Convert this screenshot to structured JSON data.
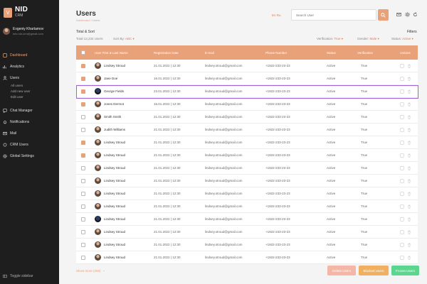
{
  "brand": {
    "logo_letter": "V",
    "name": "NID",
    "sub": "CRM"
  },
  "profile": {
    "name": "Evgeniy Khartamov",
    "email": "info.nid.crm@gmail.com"
  },
  "nav": {
    "dashboard": "Dashboard",
    "analytics": "Analytics",
    "users": "Users",
    "all_users": "All users",
    "add_user": "Add new user",
    "edit_user": "Edit user",
    "chat": "Chat Manager",
    "notifications": "Notifications",
    "mail": "Mail",
    "crm_users": "CRM Users",
    "settings": "Global Settings",
    "toggle": "Toggle sidebar"
  },
  "header": {
    "title": "Users",
    "crumb_home": "Dashboard",
    "crumb_sep": " / ",
    "crumb_current": "Users",
    "lang": "En  Ru",
    "search_placeholder": "Search User"
  },
  "toolbar": {
    "total_sort": "Total & Sort",
    "filters": "Filters",
    "total": "Total 13,234 Users",
    "sort_label": "Sort By:",
    "sort_value": "ABC",
    "verification_label": "Verification:",
    "verification_value": "True",
    "gender_label": "Gender:",
    "gender_value": "Male",
    "status_label": "Status:",
    "status_value": "Active"
  },
  "columns": [
    "User First & Last Name",
    "Registration Date",
    "E-mail",
    "Phone Number",
    "Status",
    "Verification",
    "Actions"
  ],
  "rows": [
    {
      "name": "Lindsey Stroud",
      "date": "21.01.2022 | 12:30",
      "email": "lindsey.stroud@gmail.com",
      "phone": "+1922-233-23-23",
      "status": "Active",
      "verification": "True",
      "checked": true,
      "avatar": "light"
    },
    {
      "name": "Jane Doe",
      "date": "16.01.2022 | 12:30",
      "email": "lindsey.stroud@gmail.com",
      "phone": "+1922-233-23-23",
      "status": "Active",
      "verification": "True",
      "checked": true,
      "avatar": "light"
    },
    {
      "name": "George Fields",
      "date": "23.01.2022 | 12:30",
      "email": "lindsey.stroud@gmail.com",
      "phone": "+1922-233-23-23",
      "status": "Active",
      "verification": "True",
      "checked": true,
      "avatar": "dark"
    },
    {
      "name": "Jones Dermot",
      "date": "16.01.2022 | 12:30",
      "email": "lindsey.stroud@gmail.com",
      "phone": "+1922-233-23-23",
      "status": "Active",
      "verification": "True",
      "checked": true,
      "avatar": "light"
    },
    {
      "name": "Smith Smith",
      "date": "21.01.2022 | 12:30",
      "email": "lindsey.stroud@gmail.com",
      "phone": "+1922-233-23-23",
      "status": "Active",
      "verification": "True",
      "checked": false,
      "avatar": "light"
    },
    {
      "name": "Judith Williams",
      "date": "21.01.2022 | 12:30",
      "email": "lindsey.stroud@gmail.com",
      "phone": "+1922-233-23-23",
      "status": "Active",
      "verification": "True",
      "checked": false,
      "avatar": "light"
    },
    {
      "name": "Lindsey Stroud",
      "date": "21.01.2022 | 12:30",
      "email": "lindsey.stroud@gmail.com",
      "phone": "+1922-233-23-23",
      "status": "Active",
      "verification": "True",
      "checked": true,
      "avatar": "light"
    },
    {
      "name": "Lindsey Stroud",
      "date": "21.01.2022 | 12:30",
      "email": "lindsey.stroud@gmail.com",
      "phone": "+1922-233-23-23",
      "status": "Active",
      "verification": "True",
      "checked": true,
      "avatar": "light"
    },
    {
      "name": "Lindsey Stroud",
      "date": "21.01.2022 | 12:30",
      "email": "lindsey.stroud@gmail.com",
      "phone": "+1922-233-23-23",
      "status": "Active",
      "verification": "True",
      "checked": false,
      "avatar": "light"
    },
    {
      "name": "Lindsey Stroud",
      "date": "21.01.2022 | 12:30",
      "email": "lindsey.stroud@gmail.com",
      "phone": "+1922-233-23-23",
      "status": "Active",
      "verification": "True",
      "checked": false,
      "avatar": "light"
    },
    {
      "name": "Lindsey Stroud",
      "date": "21.01.2022 | 12:30",
      "email": "lindsey.stroud@gmail.com",
      "phone": "+1922-233-23-23",
      "status": "Active",
      "verification": "True",
      "checked": false,
      "avatar": "light"
    },
    {
      "name": "Lindsey Stroud",
      "date": "21.01.2022 | 12:30",
      "email": "lindsey.stroud@gmail.com",
      "phone": "+1922-233-23-23",
      "status": "Active",
      "verification": "True",
      "checked": false,
      "avatar": "light"
    },
    {
      "name": "Lindsey Stroud",
      "date": "21.01.2022 | 12:30",
      "email": "lindsey.stroud@gmail.com",
      "phone": "+1922-233-23-23",
      "status": "Active",
      "verification": "True",
      "checked": false,
      "avatar": "dark"
    },
    {
      "name": "Lindsey Stroud",
      "date": "21.01.2022 | 12:30",
      "email": "lindsey.stroud@gmail.com",
      "phone": "+1922-233-23-23",
      "status": "Active",
      "verification": "True",
      "checked": false,
      "avatar": "light"
    },
    {
      "name": "Lindsey Stroud",
      "date": "21.01.2022 | 12:30",
      "email": "lindsey.stroud@gmail.com",
      "phone": "+1922-233-23-23",
      "status": "Active",
      "verification": "True",
      "checked": false,
      "avatar": "light"
    },
    {
      "name": "Lindsey Stroud",
      "date": "21.01.2022 | 12:30",
      "email": "lindsey.stroud@gmail.com",
      "phone": "+1922-233-23-23",
      "status": "Active",
      "verification": "True",
      "checked": false,
      "avatar": "light"
    }
  ],
  "footer": {
    "show_more": "Show more (256)",
    "delete": "Delete Users",
    "blocked": "Blocked Users",
    "frozen": "Frozen Users"
  },
  "colors": {
    "accent": "#e8a178",
    "sidebar": "#1e1e1e",
    "selection": "#a462d9",
    "blocked": "#f0b060",
    "frozen": "#5cd68f",
    "delete": "#f4b7a7"
  },
  "icons": [
    "dashboard-icon",
    "analytics-icon",
    "users-icon",
    "chat-icon",
    "bell-icon",
    "mail-icon",
    "crm-icon",
    "settings-icon",
    "search-icon",
    "edit-icon",
    "trash-icon"
  ]
}
